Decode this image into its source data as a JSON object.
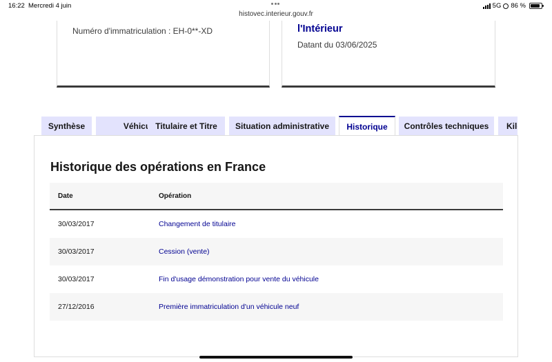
{
  "status_bar": {
    "time": "16:22",
    "date": "Mercredi 4 juin",
    "url": "histovec.interieur.gouv.fr",
    "network": "5G",
    "battery": "86 %",
    "battery_level": 0.86
  },
  "card_left": {
    "plate_text": "Numéro d'immatriculation : EH-0**-XD"
  },
  "card_right": {
    "title": "l'Intérieur",
    "date_text": "Datant du 03/06/2025"
  },
  "tabs": [
    {
      "label": "Synthèse",
      "active": false
    },
    {
      "label": "Véhicule",
      "active": false
    },
    {
      "label": "Titulaire et Titre",
      "active": false
    },
    {
      "label": "Situation administrative",
      "active": false
    },
    {
      "label": "Historique",
      "active": true
    },
    {
      "label": "Contrôles techniques",
      "active": false
    },
    {
      "label": "Kilo",
      "active": false
    }
  ],
  "history": {
    "title": "Historique des opérations en France",
    "columns": {
      "date": "Date",
      "operation": "Opération"
    },
    "rows": [
      {
        "date": "30/03/2017",
        "operation": "Changement de titulaire"
      },
      {
        "date": "30/03/2017",
        "operation": "Cession (vente)"
      },
      {
        "date": "30/03/2017",
        "operation": "Fin d'usage démonstration pour vente du véhicule"
      },
      {
        "date": "27/12/2016",
        "operation": "Première immatriculation d'un véhicule neuf"
      }
    ]
  },
  "colors": {
    "accent": "#000091",
    "tab_bg": "#e3e3fd",
    "row_alt": "#f6f6f6"
  }
}
